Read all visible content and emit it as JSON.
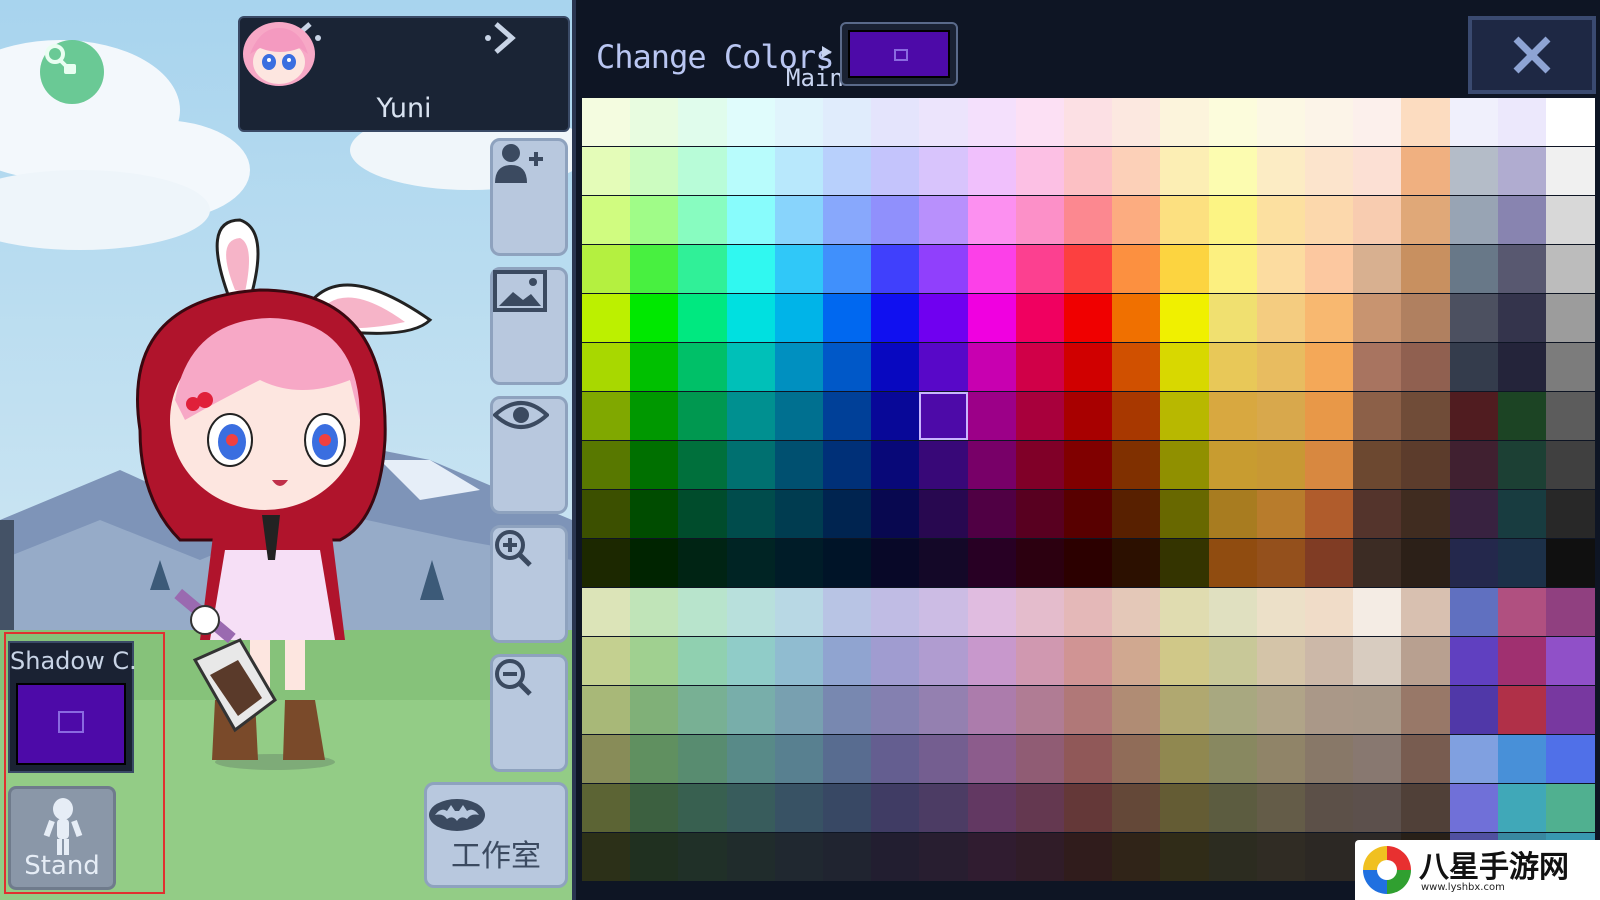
{
  "character": {
    "name": "Yuni",
    "prev_icon": "chevron-left-icon",
    "next_icon": "chevron-right-icon"
  },
  "sidebar": {
    "buttons": [
      {
        "icon": "add-person-icon"
      },
      {
        "icon": "background-image-icon"
      },
      {
        "icon": "eye-icon"
      },
      {
        "icon": "zoom-in-icon"
      },
      {
        "icon": "zoom-out-icon"
      }
    ],
    "studio_label": "工作室",
    "studio_icon": "bat-icon"
  },
  "shadow_color": {
    "title": "Shadow C.",
    "color": "#4d0aa8"
  },
  "pose": {
    "label": "Stand",
    "icon": "person-stand-icon"
  },
  "color_panel": {
    "title": "Change Colors",
    "target_label": "Main",
    "current_color": "#4d0aa8",
    "close_label": "X",
    "selected": {
      "row": 6,
      "col": 7
    },
    "rows": [
      [
        "#f4fce0",
        "#e8fce0",
        "#e0fcec",
        "#e0fcfc",
        "#e0f4fc",
        "#e0ecfc",
        "#e4e4fc",
        "#ece4fc",
        "#f4e0fc",
        "#fce0f4",
        "#fce0e4",
        "#fce8e0",
        "#fcf4dc",
        "#fcfcdc",
        "#fcf8e4",
        "#fcf4e8",
        "#fcf0ec",
        "#fcdcc0",
        "#f0f0fc",
        "#ece8fc",
        "#ffffff"
      ],
      [
        "#e4fcb8",
        "#ccfcc0",
        "#b8fcd8",
        "#b8fcfc",
        "#b8e8fc",
        "#b8d0fc",
        "#c4c4fc",
        "#d8c4fc",
        "#f0c0fc",
        "#fcc0e4",
        "#fcc0c4",
        "#fcd0b8",
        "#fceeb4",
        "#fcfcb0",
        "#fcecc4",
        "#fce4cc",
        "#fce0d4",
        "#f0b080",
        "#b4bcc8",
        "#b0acd0",
        "#f0f0f0"
      ],
      [
        "#d0fc80",
        "#a0fc88",
        "#88fcc0",
        "#88fcfc",
        "#88d4fc",
        "#88a8fc",
        "#9090fc",
        "#b890fc",
        "#fc90f0",
        "#fc90c8",
        "#fc8890",
        "#fcac80",
        "#fce080",
        "#fcf484",
        "#fce0a0",
        "#fcd8ac",
        "#f8ccb0",
        "#e0a878",
        "#98a4b4",
        "#8884b0",
        "#d8d8d8"
      ],
      [
        "#b4f040",
        "#48f040",
        "#30f098",
        "#30f8f0",
        "#30c8f8",
        "#4090fc",
        "#4040fc",
        "#9040fc",
        "#fc40e8",
        "#fc4090",
        "#fc4040",
        "#fc9040",
        "#fcd440",
        "#fcf080",
        "#fcdca0",
        "#fcc8a0",
        "#d8b090",
        "#c89060",
        "#687888",
        "#585870",
        "#bcbcbc"
      ],
      [
        "#bcf000",
        "#00e800",
        "#00e880",
        "#00e0e0",
        "#00b4e8",
        "#0068f0",
        "#1010f0",
        "#7000f0",
        "#f000e0",
        "#f00060",
        "#f00000",
        "#f07000",
        "#f0f000",
        "#f0e070",
        "#f4cc80",
        "#f8b870",
        "#c89470",
        "#b08060",
        "#4c5060",
        "#34344c",
        "#9c9c9c"
      ],
      [
        "#a8d800",
        "#00c000",
        "#00c068",
        "#00c0b8",
        "#0090c0",
        "#0058c8",
        "#0808c0",
        "#5808c8",
        "#c800b0",
        "#d00048",
        "#d00000",
        "#d05000",
        "#d8d800",
        "#e8c858",
        "#e8bc60",
        "#f4a858",
        "#a87460",
        "#906050",
        "#343c4c",
        "#24243a",
        "#7c7c7c"
      ],
      [
        "#80a800",
        "#009800",
        "#009850",
        "#009090",
        "#007090",
        "#004098",
        "#080898",
        "#4808a0",
        "#9c0088",
        "#a8003c",
        "#a80000",
        "#a83800",
        "#b8b800",
        "#d8a840",
        "#d8a84c",
        "#e89848",
        "#8c6048",
        "#704c38",
        "#501c20",
        "#1c4424",
        "#5c5c5c"
      ],
      [
        "#587800",
        "#007000",
        "#00703c",
        "#007070",
        "#005070",
        "#003078",
        "#080878",
        "#380878",
        "#780068",
        "#800028",
        "#800000",
        "#803000",
        "#909000",
        "#c89c30",
        "#c89834",
        "#d88840",
        "#6c4830",
        "#5c3c2c",
        "#402030",
        "#1c4034",
        "#404040"
      ],
      [
        "#3c5000",
        "#004c00",
        "#004c2c",
        "#004c4c",
        "#003c50",
        "#002450",
        "#080850",
        "#280850",
        "#500044",
        "#580020",
        "#580000",
        "#582000",
        "#686800",
        "#a87c20",
        "#b87c2c",
        "#b05c2c",
        "#54342c",
        "#402c20",
        "#382240",
        "#183c40",
        "#282828"
      ],
      [
        "#1c2800",
        "#002400",
        "#002414",
        "#002424",
        "#001c28",
        "#001428",
        "#080828",
        "#140828",
        "#280024",
        "#2c0010",
        "#2c0000",
        "#2c1000",
        "#343400",
        "#904c10",
        "#94501c",
        "#803c24",
        "#3c2c24",
        "#2c2018",
        "#24284c",
        "#1c3048",
        "#101010"
      ],
      [
        "#dce4b8",
        "#c0e4b8",
        "#b8e4cc",
        "#b8e0dc",
        "#b8d8e4",
        "#b8c4e4",
        "#c0bce4",
        "#ccbce4",
        "#e0bce0",
        "#e4bccc",
        "#e4b8b8",
        "#e4c8b8",
        "#e0dcb0",
        "#e0e0c0",
        "#ece0c8",
        "#f0dcc8",
        "#f4ece4",
        "#d8c0b0",
        "#6070c0",
        "#b05080",
        "#904080"
      ],
      [
        "#c4d090",
        "#a0d090",
        "#90d0b0",
        "#90ccc8",
        "#90bcd0",
        "#90a4d0",
        "#a09cd0",
        "#b09cd0",
        "#c898cc",
        "#d098b0",
        "#d09494",
        "#d0a890",
        "#d0c888",
        "#c8c898",
        "#d4c4a8",
        "#ccb8a8",
        "#d8ccc0",
        "#b8a090",
        "#6040c0",
        "#a03070",
        "#9050c8"
      ],
      [
        "#a8b878",
        "#80b078",
        "#78b094",
        "#78aeaa",
        "#78a0b0",
        "#7888b0",
        "#8480b0",
        "#9480b0",
        "#ac7cac",
        "#b07c94",
        "#b07878",
        "#b08c74",
        "#b0a870",
        "#a8a880",
        "#b0a488",
        "#aa9888",
        "#a89888",
        "#987868",
        "#5038a8",
        "#b03048",
        "#7838a0"
      ],
      [
        "#888c58",
        "#609060",
        "#588c70",
        "#588a88",
        "#588090",
        "#586c90",
        "#645e90",
        "#745e90",
        "#8c5c8c",
        "#905c74",
        "#905858",
        "#906c58",
        "#908850",
        "#888860",
        "#908468",
        "#887868",
        "#887870",
        "#785c50",
        "#80a0e0",
        "#4890d8",
        "#5070e8"
      ],
      [
        "#5c6434",
        "#3c6040",
        "#386050",
        "#385c5c",
        "#385264",
        "#384864",
        "#403c64",
        "#4c3c64",
        "#623862",
        "#643850",
        "#643838",
        "#644838",
        "#645c34",
        "#5c5c40",
        "#645c48",
        "#5c5048",
        "#5c504c",
        "#504038",
        "#7070d8",
        "#40a8b8",
        "#50b090"
      ],
      [
        "#2c3018",
        "#203020",
        "#203028",
        "#202c2c",
        "#202830",
        "#202430",
        "#221e30",
        "#281e30",
        "#301c30",
        "#301c28",
        "#301c1c",
        "#302418",
        "#302c18",
        "#2c2c20",
        "#302c24",
        "#2c2824",
        "#2c2826",
        "#282018",
        "#5050a0",
        "#3888a0",
        "#3898b0"
      ]
    ]
  },
  "watermark": {
    "text": "八星手游网",
    "url": "www.lyshbx.com"
  }
}
